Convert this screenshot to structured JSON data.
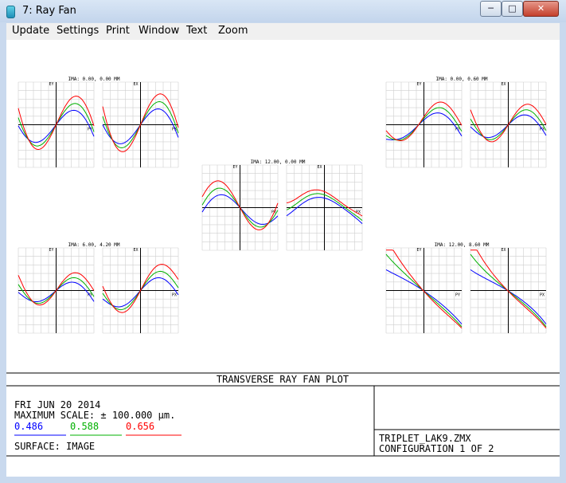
{
  "window": {
    "title": "7: Ray Fan"
  },
  "menu": [
    "Update",
    "Settings",
    "Print",
    "Window",
    "Text",
    "Zoom"
  ],
  "footer": {
    "heading": "TRANSVERSE RAY FAN PLOT",
    "date": "FRI JUN 20 2014",
    "max_scale": "MAXIMUM SCALE: ± 100.000 μm.",
    "wavelengths": [
      "0.486",
      "0.588",
      "0.656"
    ],
    "surface": "SURFACE: IMAGE",
    "file": "TRIPLET_LAK9.ZMX",
    "config": "CONFIGURATION 1 OF 2"
  },
  "colors": {
    "w1": "#0000ff",
    "w2": "#00b000",
    "w3": "#ff0000"
  },
  "plots": [
    {
      "label": "IMA: 0.00, 0.00 MM",
      "ey": "EY",
      "ex": "EX",
      "py": "PY",
      "px": "PX"
    },
    {
      "label": "IMA: 0.00, 0.60 MM",
      "ey": "EY",
      "ex": "EX",
      "py": "PY",
      "px": "PX"
    },
    {
      "label": "IMA: 12.00, 0.00 MM",
      "ey": "EY",
      "ex": "EX",
      "py": "PY",
      "px": "PX"
    },
    {
      "label": "IMA: 6.00, 4.20 MM",
      "ey": "EY",
      "ex": "EX",
      "py": "PY",
      "px": "PX"
    },
    {
      "label": "IMA: 12.00, 8.60 MM",
      "ey": "EY",
      "ex": "EX",
      "py": "PY",
      "px": "PX"
    }
  ]
}
